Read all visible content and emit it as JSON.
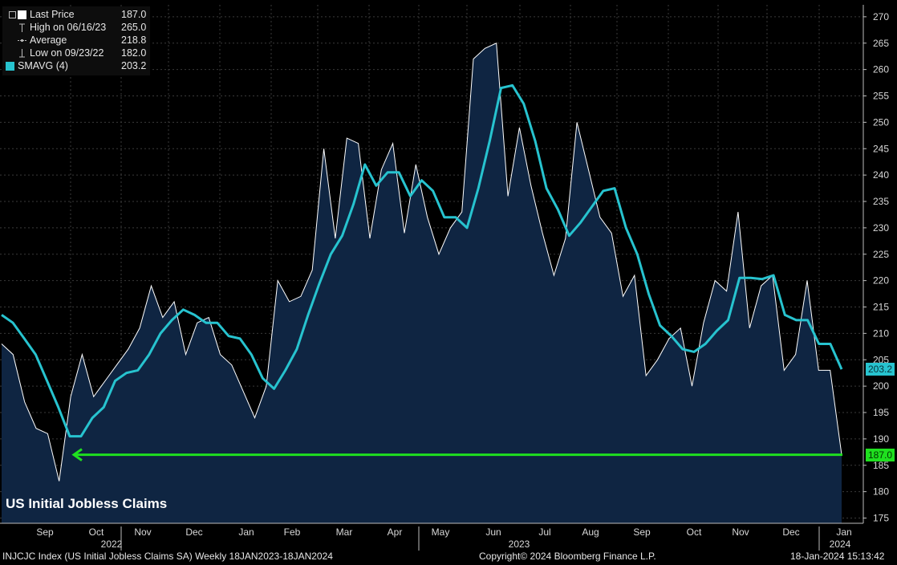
{
  "chart_data": {
    "type": "area",
    "title": "US Initial Jobless Claims",
    "ylim": [
      175,
      270
    ],
    "yticks": [
      175,
      180,
      185,
      190,
      195,
      200,
      205,
      210,
      215,
      220,
      225,
      230,
      235,
      240,
      245,
      250,
      255,
      260,
      265,
      270
    ],
    "grid": true,
    "legend_position": "top-left",
    "x_month_labels": [
      "Sep",
      "Oct",
      "Nov",
      "Dec",
      "Jan",
      "Feb",
      "Mar",
      "Apr",
      "May",
      "Jun",
      "Jul",
      "Aug",
      "Sep",
      "Oct",
      "Nov",
      "Dec",
      "Jan"
    ],
    "x_year_labels": [
      "2022",
      "2023",
      "2024"
    ],
    "series": [
      {
        "name": "Last Price",
        "color": "#ffffff",
        "fill": "#0f2542",
        "values": [
          208,
          206,
          197,
          192,
          191,
          182,
          198,
          206,
          198,
          201,
          204,
          207,
          211,
          219,
          213,
          216,
          206,
          212,
          213,
          206,
          204,
          199,
          194,
          200,
          220,
          216,
          217,
          222,
          245,
          228,
          247,
          246,
          228,
          241,
          246,
          229,
          242,
          232,
          225,
          230,
          233,
          262,
          264,
          265,
          236,
          249,
          238,
          229,
          221,
          228,
          250,
          241,
          232,
          229,
          217,
          221,
          202,
          205,
          209,
          211,
          200,
          212,
          220,
          218,
          233,
          211,
          219,
          221,
          203,
          206,
          220,
          203,
          203,
          187
        ]
      },
      {
        "name": "SMAVG (4)",
        "color": "#27c3cf",
        "values": [
          213.5,
          212,
          209,
          206,
          201,
          196,
          190.5,
          190.5,
          194,
          196,
          201,
          202.5,
          203,
          206,
          210,
          212.5,
          214.5,
          213.5,
          212,
          212,
          209.5,
          209,
          206,
          201.5,
          199.5,
          203,
          207,
          213.5,
          219.5,
          225,
          228.5,
          234.5,
          242,
          238,
          240.5,
          240.5,
          236,
          239,
          237,
          232,
          232,
          230,
          237.5,
          246.5,
          256.5,
          257,
          253.5,
          246.5,
          237.5,
          233.5,
          228.5,
          231,
          234,
          237,
          237.5,
          230,
          225,
          217.5,
          211.5,
          209.5,
          207,
          206.5,
          208,
          210.5,
          212.5,
          220.5,
          220.5,
          220.3,
          221,
          213.5,
          212.5,
          212.5,
          208,
          208,
          203.2
        ]
      }
    ],
    "reference_line": {
      "value": 187,
      "color": "#1fe01f"
    },
    "value_tags": [
      {
        "name": "SMAVG (4)",
        "value": 203.2,
        "label": "203.2",
        "bg": "#27c3cf",
        "fg": "#06323a"
      },
      {
        "name": "Last Price",
        "value": 187.0,
        "label": "187.0",
        "bg": "#1fe01f",
        "fg": "#003300"
      }
    ]
  },
  "legend": {
    "last_price_label": "Last Price",
    "last_price_value": "187.0",
    "high_label": "High on 06/16/23",
    "high_value": "265.0",
    "average_label": "Average",
    "average_value": "218.8",
    "low_label": "Low on 09/23/22",
    "low_value": "182.0",
    "smavg_label": "SMAVG (4)",
    "smavg_value": "203.2",
    "smavg_color": "#27c3cf"
  },
  "footer": {
    "left": "INJCJC Index (US Initial Jobless Claims SA)  Weekly 18JAN2023-18JAN2024",
    "center": "Copyright© 2024 Bloomberg Finance L.P.",
    "right": "18-Jan-2024 15:13:42"
  }
}
